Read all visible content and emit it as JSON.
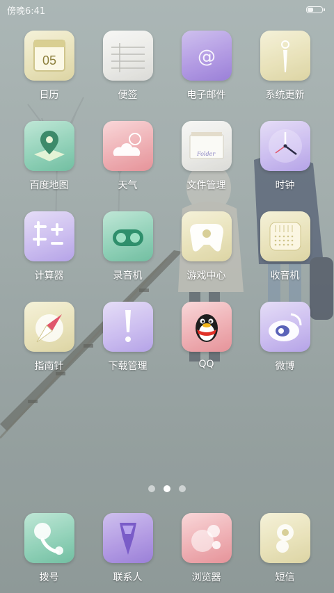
{
  "status_bar": {
    "time": "傍晚6:41",
    "battery_level_fraction": 0.4
  },
  "apps": [
    {
      "label": "日历",
      "icon": "calendar-icon",
      "color": "cream",
      "badge_text": "05"
    },
    {
      "label": "便签",
      "icon": "notes-icon",
      "color": "white"
    },
    {
      "label": "电子邮件",
      "icon": "email-icon",
      "color": "purple"
    },
    {
      "label": "系统更新",
      "icon": "update-icon",
      "color": "cream"
    },
    {
      "label": "百度地图",
      "icon": "map-icon",
      "color": "green"
    },
    {
      "label": "天气",
      "icon": "weather-icon",
      "color": "pink"
    },
    {
      "label": "文件管理",
      "icon": "folder-icon",
      "color": "white",
      "badge_text": "Folder"
    },
    {
      "label": "时钟",
      "icon": "clock-icon",
      "color": "lavender"
    },
    {
      "label": "计算器",
      "icon": "calculator-icon",
      "color": "lavender"
    },
    {
      "label": "录音机",
      "icon": "recorder-icon",
      "color": "green"
    },
    {
      "label": "游戏中心",
      "icon": "gamepad-icon",
      "color": "cream"
    },
    {
      "label": "收音机",
      "icon": "radio-icon",
      "color": "cream"
    },
    {
      "label": "指南针",
      "icon": "compass-icon",
      "color": "cream"
    },
    {
      "label": "下载管理",
      "icon": "download-icon",
      "color": "lavender"
    },
    {
      "label": "QQ",
      "icon": "qq-penguin-icon",
      "color": "pink"
    },
    {
      "label": "微博",
      "icon": "weibo-icon",
      "color": "lavender"
    }
  ],
  "page_indicator": {
    "pages": 3,
    "active_index": 1
  },
  "dock": [
    {
      "label": "拨号",
      "icon": "phone-icon",
      "color": "green"
    },
    {
      "label": "联系人",
      "icon": "contacts-icon",
      "color": "purple"
    },
    {
      "label": "浏览器",
      "icon": "browser-icon",
      "color": "pink"
    },
    {
      "label": "短信",
      "icon": "sms-icon",
      "color": "cream"
    }
  ],
  "colors": {
    "cream": "#e6dfb2",
    "white": "#e6e6e2",
    "purple": "#a98ee0",
    "green": "#84ccb0",
    "pink": "#eda6ab",
    "lavender": "#c6b6ee",
    "label_text": "#ffffff"
  }
}
